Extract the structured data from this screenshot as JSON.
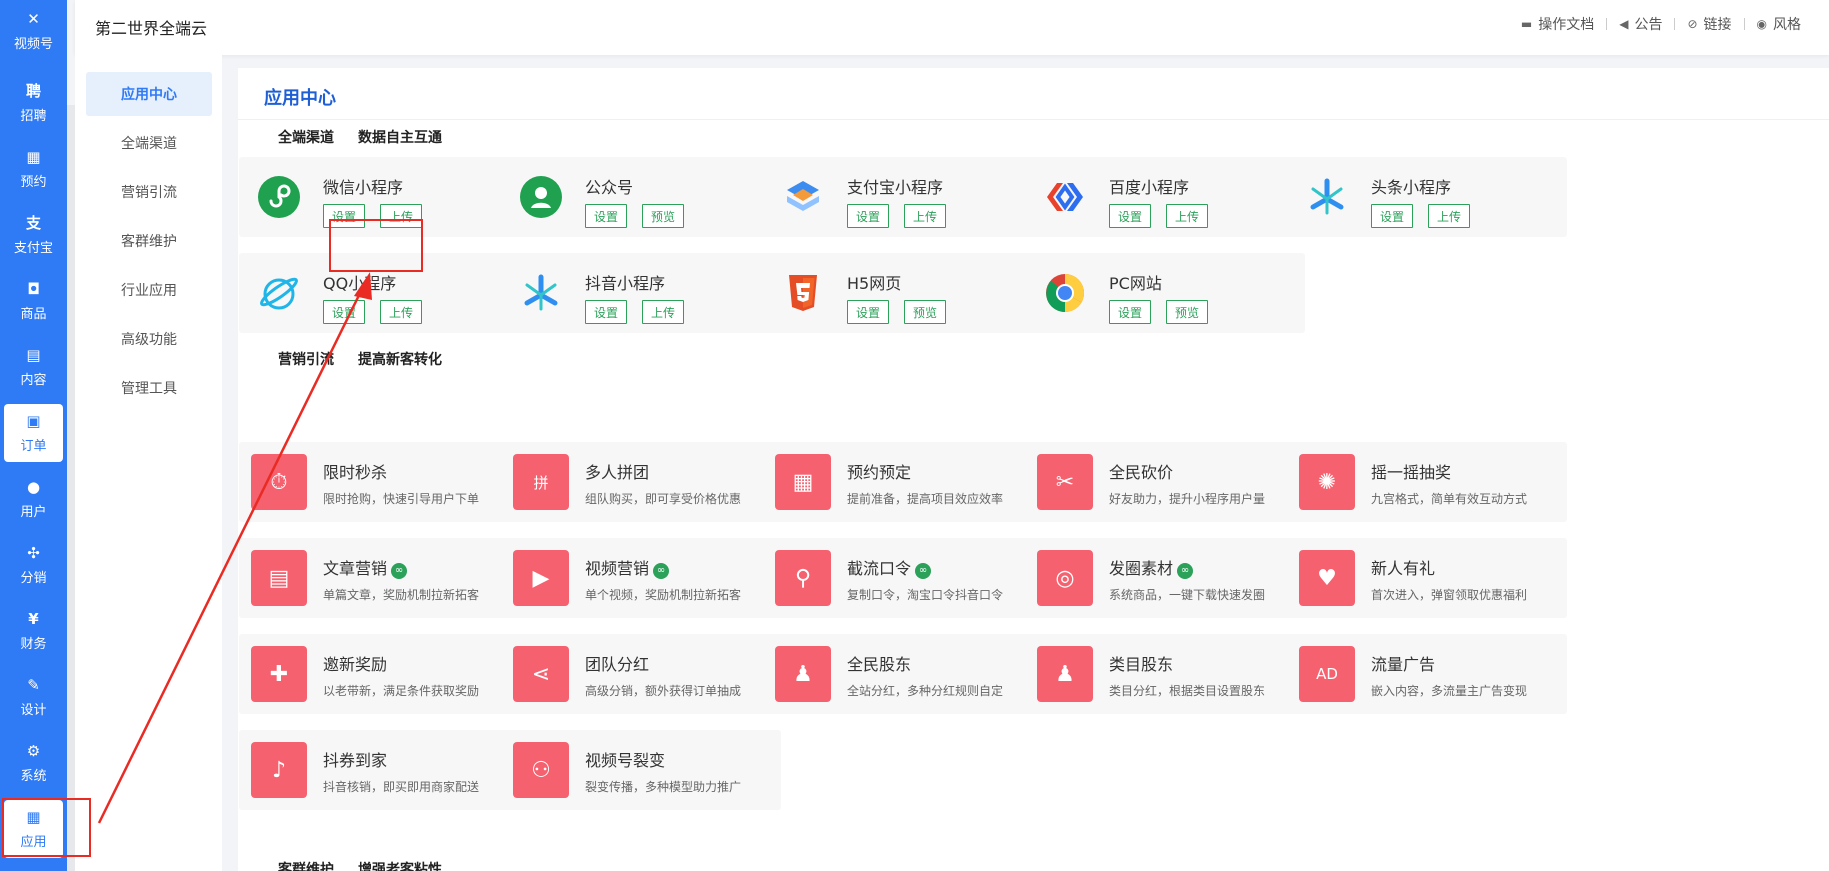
{
  "rail": {
    "items": [
      {
        "label": "视频号",
        "icon": "video-channel-icon",
        "glyph": "✕",
        "active": false
      },
      {
        "label": "招聘",
        "icon": "recruit-icon",
        "glyph": "聘",
        "active": false
      },
      {
        "label": "预约",
        "icon": "calendar-icon",
        "glyph": "▦",
        "active": false
      },
      {
        "label": "支付宝",
        "icon": "alipay-icon",
        "glyph": "支",
        "active": false
      },
      {
        "label": "商品",
        "icon": "goods-bag-icon",
        "glyph": "◘",
        "active": false
      },
      {
        "label": "内容",
        "icon": "content-doc-icon",
        "glyph": "▤",
        "active": false
      },
      {
        "label": "订单",
        "icon": "order-clipboard-icon",
        "glyph": "▣",
        "active": true
      },
      {
        "label": "用户",
        "icon": "user-icon",
        "glyph": "●",
        "active": false
      },
      {
        "label": "分销",
        "icon": "distribution-icon",
        "glyph": "✣",
        "active": false
      },
      {
        "label": "财务",
        "icon": "finance-money-bag-icon",
        "glyph": "¥",
        "active": false
      },
      {
        "label": "设计",
        "icon": "design-brush-icon",
        "glyph": "✎",
        "active": false
      },
      {
        "label": "系统",
        "icon": "system-gear-icon",
        "glyph": "⚙",
        "active": false
      },
      {
        "label": "应用",
        "icon": "apps-grid-icon",
        "glyph": "▦",
        "active": true
      }
    ]
  },
  "header": {
    "brand": "第二世界全端云",
    "links": [
      {
        "label": "操作文档",
        "icon": "folder-icon",
        "glyph": "▬"
      },
      {
        "label": "公告",
        "icon": "speaker-icon",
        "glyph": "◀"
      },
      {
        "label": "链接",
        "icon": "link-icon",
        "glyph": "⊘"
      },
      {
        "label": "风格",
        "icon": "palette-icon",
        "glyph": "◉"
      }
    ]
  },
  "subnav": {
    "items": [
      "应用中心",
      "全端渠道",
      "营销引流",
      "客群维护",
      "行业应用",
      "高级功能",
      "管理工具"
    ],
    "active_index": 0
  },
  "main": {
    "title": "应用中心",
    "sections": [
      {
        "name": "全端渠道",
        "tagline": "数据自主互通"
      },
      {
        "name": "营销引流",
        "tagline": "提高新客转化"
      },
      {
        "name": "客群维护",
        "tagline": "增强老客粘性"
      }
    ],
    "channels": [
      {
        "name": "微信小程序",
        "icon": "wechat-miniprogram-icon",
        "buttons": [
          "设置",
          "上传"
        ]
      },
      {
        "name": "公众号",
        "icon": "wechat-official-account-icon",
        "buttons": [
          "设置",
          "预览"
        ]
      },
      {
        "name": "支付宝小程序",
        "icon": "alipay-miniprogram-icon",
        "buttons": [
          "设置",
          "上传"
        ]
      },
      {
        "name": "百度小程序",
        "icon": "baidu-miniprogram-icon",
        "buttons": [
          "设置",
          "上传"
        ]
      },
      {
        "name": "头条小程序",
        "icon": "toutiao-miniprogram-icon",
        "buttons": [
          "设置",
          "上传"
        ]
      },
      {
        "name": "QQ小程序",
        "icon": "qq-miniprogram-icon",
        "buttons": [
          "设置",
          "上传"
        ]
      },
      {
        "name": "抖音小程序",
        "icon": "douyin-miniprogram-icon",
        "buttons": [
          "设置",
          "上传"
        ]
      },
      {
        "name": "H5网页",
        "icon": "html5-icon",
        "buttons": [
          "设置",
          "预览"
        ]
      },
      {
        "name": "PC网站",
        "icon": "chrome-browser-icon",
        "buttons": [
          "设置",
          "预览"
        ]
      }
    ],
    "marketing": [
      {
        "name": "限时秒杀",
        "desc": "限时抢购，快速引导用户下单",
        "icon": "stopwatch-icon",
        "glyph": "⏱",
        "badge": false
      },
      {
        "name": "多人拼团",
        "desc": "组队购买，即可享受价格优惠",
        "icon": "group-buy-bag-icon",
        "glyph": "拼",
        "badge": false
      },
      {
        "name": "预约预定",
        "desc": "提前准备，提高项目效应效率",
        "icon": "reservation-calendar-icon",
        "glyph": "▦",
        "badge": false
      },
      {
        "name": "全民砍价",
        "desc": "好友助力，提升小程序用户量",
        "icon": "bargain-tag-icon",
        "glyph": "✂",
        "badge": false
      },
      {
        "name": "摇一摇抽奖",
        "desc": "九宫格式，简单有效互动方式",
        "icon": "lottery-wheel-icon",
        "glyph": "✺",
        "badge": false
      },
      {
        "name": "文章营销",
        "desc": "单篇文章，奖励机制拉新拓客",
        "icon": "article-icon",
        "glyph": "▤",
        "badge": true
      },
      {
        "name": "视频营销",
        "desc": "单个视频，奖励机制拉新拓客",
        "icon": "video-play-icon",
        "glyph": "▶",
        "badge": true
      },
      {
        "name": "截流口令",
        "desc": "复制口令，淘宝口令抖音口令",
        "icon": "password-search-icon",
        "glyph": "⚲",
        "badge": true
      },
      {
        "name": "发圈素材",
        "desc": "系统商品，一键下载快速发圈",
        "icon": "moments-camera-icon",
        "glyph": "◎",
        "badge": true
      },
      {
        "name": "新人有礼",
        "desc": "首次进入，弹窗领取优惠福利",
        "icon": "newcomer-gift-hand-icon",
        "glyph": "♥",
        "badge": false
      },
      {
        "name": "邀新奖励",
        "desc": "以老带新，满足条件获取奖励",
        "icon": "gift-box-icon",
        "glyph": "✚",
        "badge": false
      },
      {
        "name": "团队分红",
        "desc": "高级分销，额外获得订单抽成",
        "icon": "share-nodes-icon",
        "glyph": "⋖",
        "badge": false
      },
      {
        "name": "全民股东",
        "desc": "全站分红，多种分红规则自定",
        "icon": "shareholder-user-icon",
        "glyph": "♟",
        "badge": false
      },
      {
        "name": "类目股东",
        "desc": "类目分红，根据类目设置股东",
        "icon": "category-shareholder-icon",
        "glyph": "♟",
        "badge": false
      },
      {
        "name": "流量广告",
        "desc": "嵌入内容，多流量主广告变现",
        "icon": "ad-icon",
        "glyph": "AD",
        "badge": false
      },
      {
        "name": "抖券到家",
        "desc": "抖音核销，即买即用商家配送",
        "icon": "douyin-coupon-icon",
        "glyph": "♪",
        "badge": false
      },
      {
        "name": "视频号裂变",
        "desc": "裂变传播，多种模型助力推广",
        "icon": "video-channel-fission-icon",
        "glyph": "⚇",
        "badge": false
      }
    ]
  },
  "colors": {
    "rail": "#2f7af5",
    "title": "#1f5fd6",
    "green": "#2ba15a",
    "pink": "#f5616f",
    "annotation": "#ea2b23"
  }
}
